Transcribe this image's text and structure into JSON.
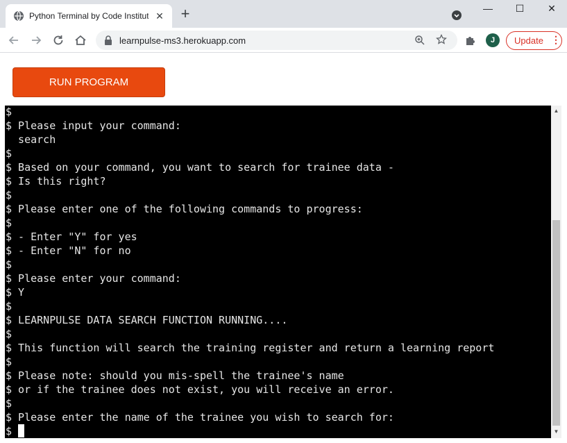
{
  "browser": {
    "tab_title": "Python Terminal by Code Institute",
    "tab_close": "✕",
    "new_tab": "+",
    "url": "learnpulse-ms3.herokuapp.com",
    "avatar_initial": "J",
    "update_label": "Update",
    "update_menu": "⋮",
    "window_min": "—",
    "window_max": "☐",
    "window_close": "✕"
  },
  "page": {
    "run_button": "RUN PROGRAM"
  },
  "terminal": {
    "lines": [
      "$",
      "$ Please input your command:",
      "  search",
      "$",
      "$ Based on your command, you want to search for trainee data -",
      "$ Is this right?",
      "$",
      "$ Please enter one of the following commands to progress:",
      "$",
      "$ - Enter \"Y\" for yes",
      "$ - Enter \"N\" for no",
      "$",
      "$ Please enter your command:",
      "$ Y",
      "$",
      "$ LEARNPULSE DATA SEARCH FUNCTION RUNNING....",
      "$",
      "$ This function will search the training register and return a learning report",
      "$",
      "$ Please note: should you mis-spell the trainee's name",
      "$ or if the trainee does not exist, you will receive an error.",
      "$",
      "$ Please enter the name of the trainee you wish to search for:",
      "$"
    ]
  },
  "scrollbar": {
    "position_fraction": 0.95
  },
  "colors": {
    "run_button": "#e8490f",
    "terminal_bg": "#000000",
    "terminal_text": "#e6e6e6",
    "update_accent": "#d93025"
  },
  "icons": {
    "favicon": "globe-icon",
    "back": "arrow-left-icon",
    "forward": "arrow-right-icon",
    "reload": "reload-icon",
    "home": "home-icon",
    "lock": "lock-icon",
    "zoom": "zoom-icon",
    "bookmark": "star-icon",
    "extensions": "puzzle-icon"
  }
}
